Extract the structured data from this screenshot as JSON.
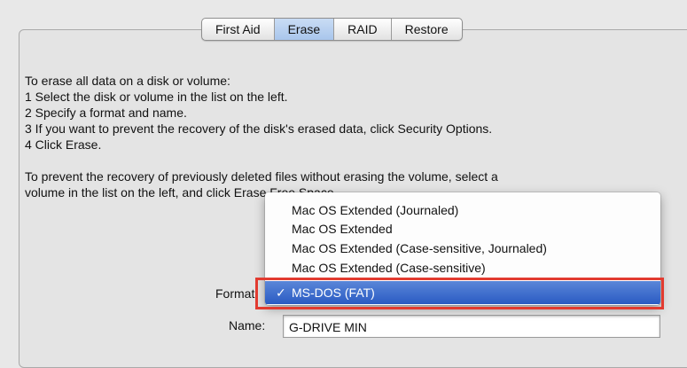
{
  "tabs": [
    {
      "label": "First Aid"
    },
    {
      "label": "Erase"
    },
    {
      "label": "RAID"
    },
    {
      "label": "Restore"
    }
  ],
  "active_tab": "Erase",
  "instructions": {
    "lines": [
      "To erase all data on a disk or volume:",
      "1 Select the disk or volume in the list on the left.",
      "2 Specify a format and name.",
      "3 If you want to prevent the recovery of the disk's erased data, click Security Options.",
      "4 Click Erase."
    ],
    "para2_line1": "To prevent the recovery of previously deleted files without erasing the volume, select a",
    "para2_line2": "volume in the list on the left, and click Erase Free Space."
  },
  "form": {
    "format_label": "Format:",
    "name_label": "Name:",
    "name_value": "G-DRIVE MIN"
  },
  "format_menu": {
    "options": [
      "Mac OS Extended (Journaled)",
      "Mac OS Extended",
      "Mac OS Extended (Case-sensitive, Journaled)",
      "Mac OS Extended (Case-sensitive)"
    ],
    "selected": "MS-DOS (FAT)",
    "check_glyph": "✓"
  },
  "colors": {
    "selection": "#2a5bc3",
    "highlight_box": "#e23b30"
  }
}
